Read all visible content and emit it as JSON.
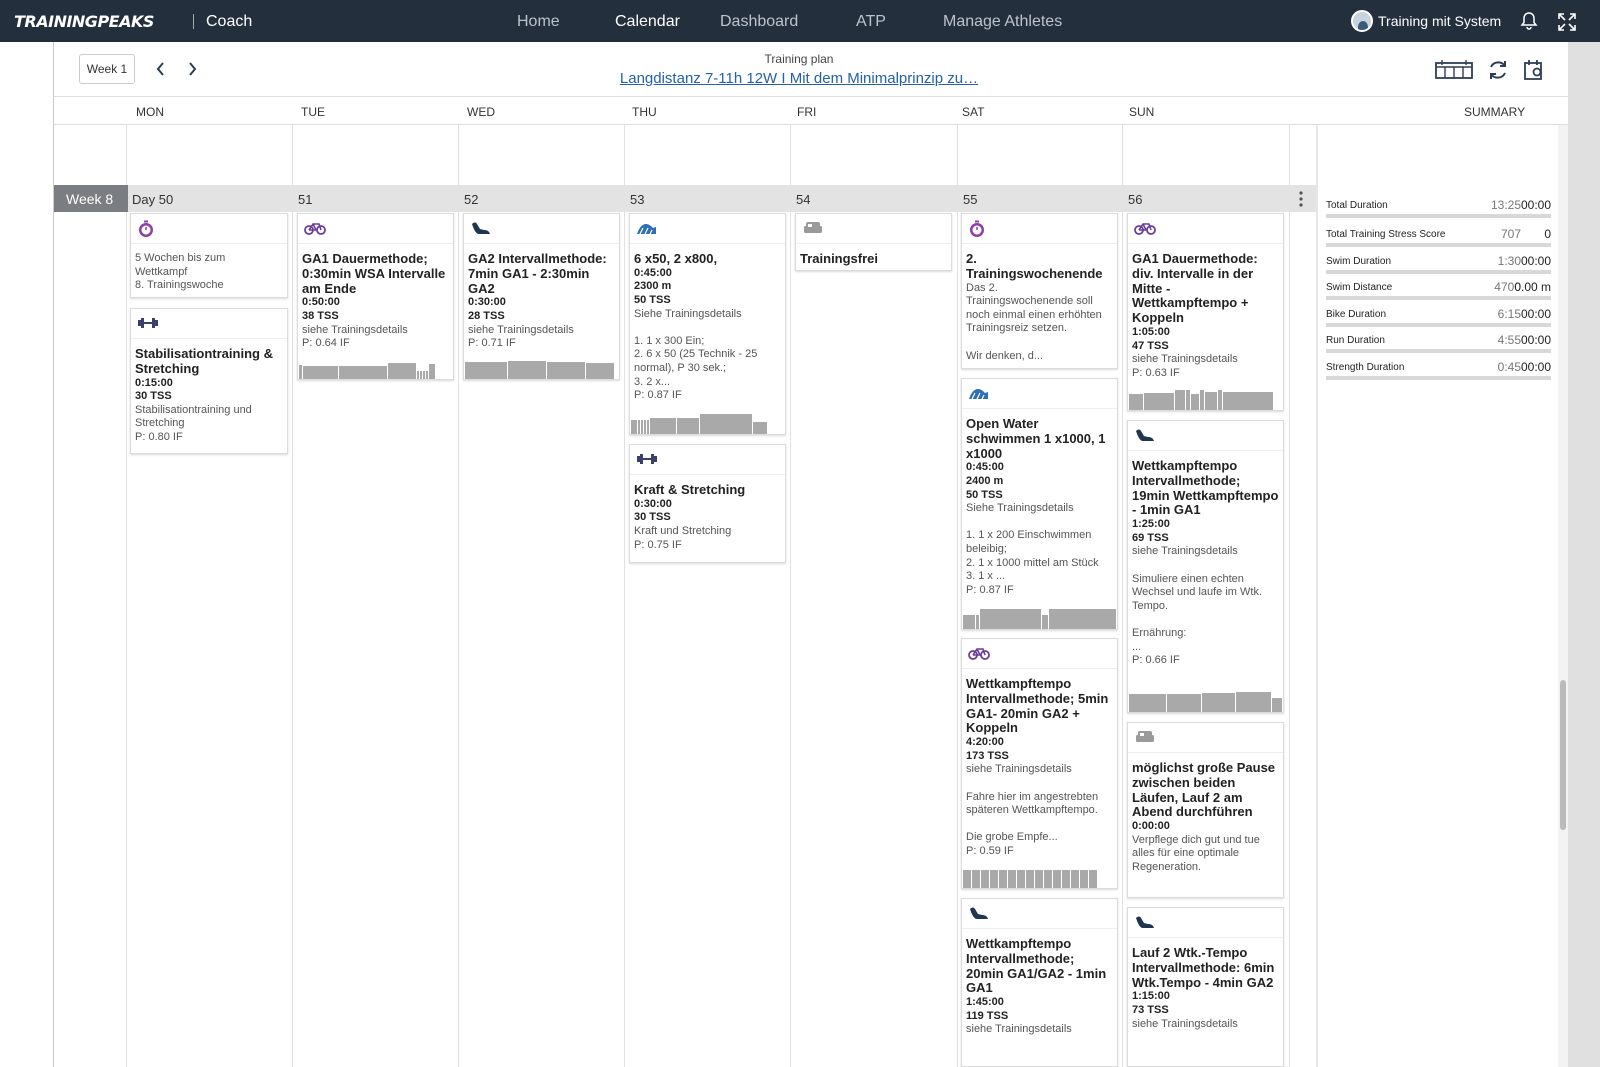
{
  "header": {
    "logo": "TRAININGPEAKS",
    "coach": "Coach",
    "nav": [
      "Home",
      "Calendar",
      "Dashboard",
      "ATP",
      "Manage Athletes"
    ],
    "active_nav": "Calendar",
    "user": "Training mit System"
  },
  "toolbar": {
    "week_select": "Week 1",
    "plan_label": "Training plan",
    "plan_title": "Langdistanz 7-11h 12W I Mit dem Minimalprinzip zu…"
  },
  "days": [
    "MON",
    "TUE",
    "WED",
    "THU",
    "FRI",
    "SAT",
    "SUN"
  ],
  "summary_header": "SUMMARY",
  "week": {
    "label": "Week 8",
    "day_numbers": [
      "Day 50",
      "51",
      "52",
      "53",
      "54",
      "55",
      "56"
    ]
  },
  "cards": [
    {
      "icon": "stopwatch",
      "lines": [],
      "desc": "5 Wochen bis zum\nWettkampf\n8. Trainingswoche"
    },
    {
      "icon": "dumbbell",
      "title": "Stabilisationtraining & Stretching",
      "lines": [
        "0:15:00",
        "30 TSS"
      ],
      "desc": "Stabilisationtraining und\nStretching",
      "if": "P: 0.80 IF"
    },
    {
      "icon": "bike",
      "title": "GA1 Dauermethode; 0:30min WSA Intervalle am Ende",
      "lines": [
        "0:50:00",
        "38 TSS"
      ],
      "desc": "siehe Trainingsdetails",
      "if": "P: 0.64 IF"
    },
    {
      "icon": "run",
      "title": "GA2 Intervallmethode: 7min GA1 - 2:30min GA2",
      "lines": [
        "0:30:00",
        "28 TSS"
      ],
      "desc": "siehe Trainingsdetails",
      "if": "P: 0.71 IF"
    },
    {
      "icon": "swim",
      "title": "6 x50, 2 x800,",
      "lines": [
        "0:45:00",
        "2300 m",
        "50 TSS"
      ],
      "desc": "Siehe Trainingsdetails\n\n1. 1 x 300 Ein;\n2. 6 x 50 (25 Technik - 25\nnormal), P 30 sek.;\n3. 2 x...",
      "if": "P: 0.87 IF"
    },
    {
      "icon": "dumbbell",
      "title": "Kraft & Stretching",
      "lines": [
        "0:30:00",
        "30 TSS"
      ],
      "desc": "Kraft und Stretching",
      "if": "P: 0.75 IF"
    },
    {
      "icon": "rest",
      "title": "Trainingsfrei",
      "lines": []
    },
    {
      "icon": "stopwatch",
      "title": "2. Trainingswochenende",
      "lines": [],
      "desc": "Das 2.\nTrainingswochenende soll\nnoch einmal einen erhöhten\nTrainingsreiz setzen.\n\nWir denken, d..."
    },
    {
      "icon": "swim",
      "title": "Open Water schwimmen 1 x1000, 1 x1000",
      "lines": [
        "0:45:00",
        "2400 m",
        "50 TSS"
      ],
      "desc": "Siehe Trainingsdetails\n\n1. 1 x 200 Einschwimmen\nbeleibig;\n2. 1 x 1000 mittel am Stück\n3. 1 x ...",
      "if": "P: 0.87 IF"
    },
    {
      "icon": "bike",
      "title": "Wettkampftempo Intervallmethode; 5min GA1- 20min GA2 + Koppeln",
      "lines": [
        "4:20:00",
        "173 TSS"
      ],
      "desc": "siehe Trainingsdetails\n\nFahre hier im angestrebten\nspäteren Wettkampftempo.\n\nDie grobe Empfe...",
      "if": "P: 0.59 IF"
    },
    {
      "icon": "run",
      "title": "Wettkampftempo Intervallmethode; 20min GA1/GA2 - 1min GA1",
      "lines": [
        "1:45:00",
        "119 TSS"
      ],
      "desc": "siehe Trainingsdetails"
    },
    {
      "icon": "bike",
      "title": "GA1 Dauermethode: div. Intervalle in der Mitte - Wettkampftempo + Koppeln",
      "lines": [
        "1:05:00",
        "47 TSS"
      ],
      "desc": "siehe Trainingsdetails",
      "if": "P: 0.63 IF"
    },
    {
      "icon": "run",
      "title": "Wettkampftempo Intervallmethode; 19min Wettkampftempo - 1min GA1",
      "lines": [
        "1:25:00",
        "69 TSS"
      ],
      "desc": "siehe Trainingsdetails\n\nSimuliere einen echten\nWechsel und laufe im Wtk.\nTempo.\n\nErnährung:\n...",
      "if": "P: 0.66 IF"
    },
    {
      "icon": "rest",
      "title": "möglichst große Pause zwischen beiden Läufen, Lauf 2 am Abend durchführen",
      "lines": [
        "0:00:00"
      ],
      "desc": "Verpflege dich gut und tue\nalles für eine optimale\nRegeneration."
    },
    {
      "icon": "run",
      "title": "Lauf 2 Wtk.-Tempo Intervallmethode: 6min Wtk.Tempo - 4min GA2",
      "lines": [
        "1:15:00",
        "73 TSS"
      ],
      "desc": "siehe Trainingsdetails"
    }
  ],
  "summary": [
    {
      "label": "Total Duration",
      "planned": "13:25",
      "completed": "00:00"
    },
    {
      "label": "Total Training Stress Score",
      "planned": "707",
      "completed": "0"
    },
    {
      "label": "Swim Duration",
      "planned": "1:30",
      "completed": "00:00"
    },
    {
      "label": "Swim Distance",
      "planned": "4700",
      "completed": "0.00 m"
    },
    {
      "label": "Bike Duration",
      "planned": "6:15",
      "completed": "00:00"
    },
    {
      "label": "Run Duration",
      "planned": "4:55",
      "completed": "00:00"
    },
    {
      "label": "Strength Duration",
      "planned": "0:45",
      "completed": "00:00"
    }
  ],
  "colors": {
    "nav_bg": "#242f3e",
    "link": "#2462a8",
    "stopwatch": "#8e3fa9",
    "bike": "#6a3e9a",
    "run": "#1f3550",
    "swim": "#2f6fb8",
    "strength": "#3b3f6b",
    "rest": "#9a9a9a",
    "week_label_bg": "#7a7d82"
  }
}
